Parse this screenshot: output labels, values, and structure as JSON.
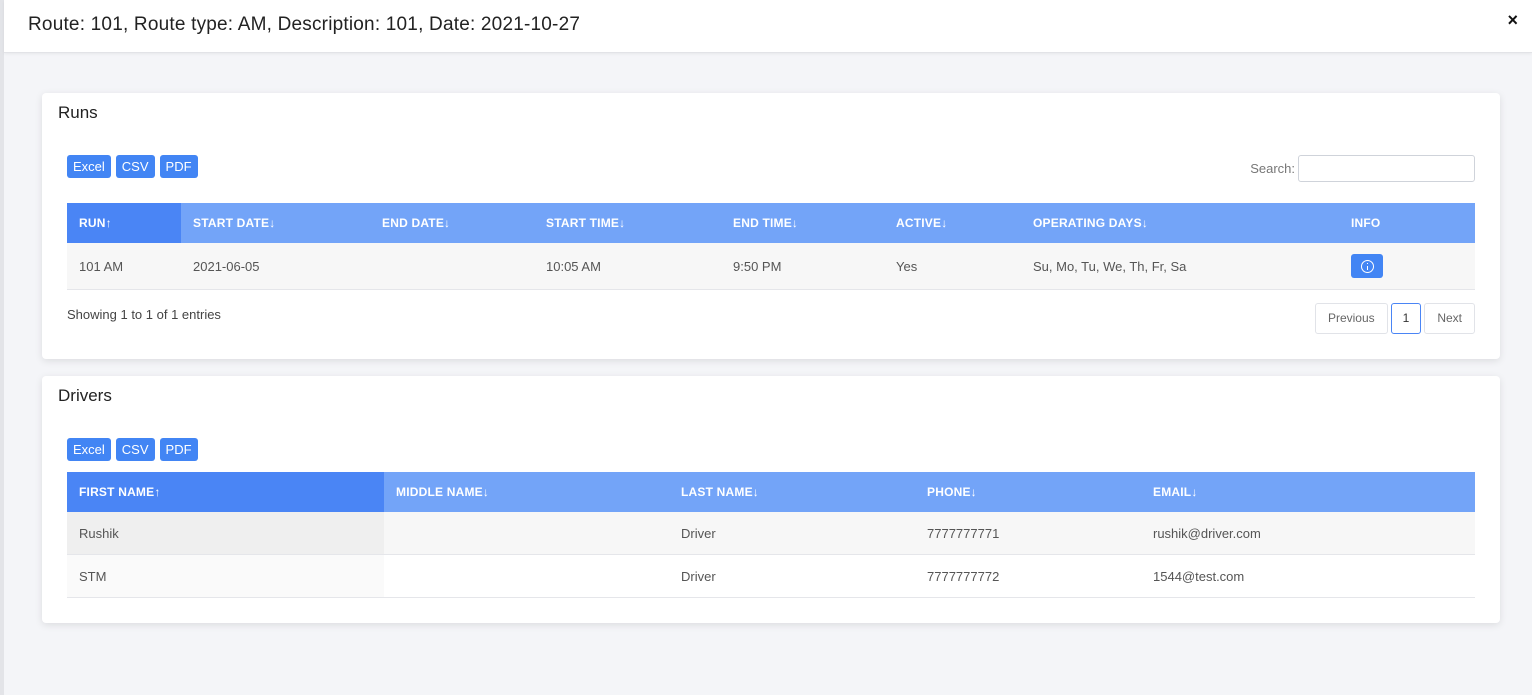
{
  "modal": {
    "title": "Route: 101, Route type: AM, Description: 101, Date: 2021-10-27",
    "close_symbol": "×"
  },
  "runs": {
    "title": "Runs",
    "export_buttons": [
      "Excel",
      "CSV",
      "PDF"
    ],
    "search": {
      "label": "Search:",
      "value": "",
      "placeholder": ""
    },
    "columns": [
      "RUN↑",
      "START DATE↓",
      "END DATE↓",
      "START TIME↓",
      "END TIME↓",
      "ACTIVE↓",
      "OPERATING DAYS↓",
      "INFO"
    ],
    "rows": [
      {
        "run": "101 AM",
        "start_date": "2021-06-05",
        "end_date": "",
        "start_time": "10:05 AM",
        "end_time": "9:50 PM",
        "active": "Yes",
        "operating_days": "Su, Mo, Tu, We, Th, Fr, Sa",
        "info_icon": "info-circle-icon"
      }
    ],
    "entries_info": "Showing 1 to 1 of 1 entries",
    "pager": {
      "previous": "Previous",
      "current_page": "1",
      "next": "Next"
    }
  },
  "drivers": {
    "title": "Drivers",
    "export_buttons": [
      "Excel",
      "CSV",
      "PDF"
    ],
    "columns": [
      "FIRST NAME↑",
      "MIDDLE NAME↓",
      "LAST NAME↓",
      "PHONE↓",
      "EMAIL↓"
    ],
    "rows": [
      {
        "first_name": "Rushik",
        "middle_name": "",
        "last_name": "Driver",
        "phone": "7777777771",
        "email": "rushik@driver.com"
      },
      {
        "first_name": "STM",
        "middle_name": "",
        "last_name": "Driver",
        "phone": "7777777772",
        "email": "1544@test.com"
      }
    ]
  },
  "colors": {
    "header_blue": "#73a4f8",
    "sorted_header_blue": "#4a85f5",
    "button_blue": "#4285f4"
  }
}
